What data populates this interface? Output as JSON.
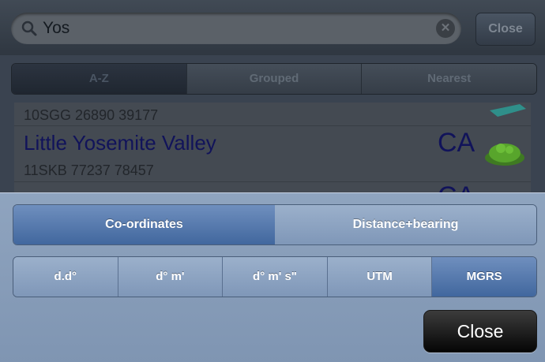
{
  "search": {
    "query": "Yos",
    "cancel_label": "Close"
  },
  "scope_tabs": [
    {
      "label": "A-Z",
      "selected": true
    },
    {
      "label": "Grouped",
      "selected": false
    },
    {
      "label": "Nearest",
      "selected": false
    }
  ],
  "results": [
    {
      "coord": "10SGG 26890 39177"
    },
    {
      "name": "Little Yosemite Valley",
      "state": "CA",
      "coord": "11SKB 77237 78457"
    },
    {
      "state": "CA"
    }
  ],
  "sheet": {
    "mode_options": [
      {
        "label": "Co-ordinates",
        "selected": true
      },
      {
        "label": "Distance+bearing",
        "selected": false
      }
    ],
    "format_options": [
      {
        "label": "d.d°",
        "selected": false
      },
      {
        "label": "d° m'",
        "selected": false
      },
      {
        "label": "d° m' s\"",
        "selected": false
      },
      {
        "label": "UTM",
        "selected": false
      },
      {
        "label": "MGRS",
        "selected": true
      }
    ],
    "close_label": "Close"
  },
  "colors": {
    "list_text": "#11135a",
    "selected_segment": "#41679e",
    "sheet_background": "#8fa4bf"
  }
}
